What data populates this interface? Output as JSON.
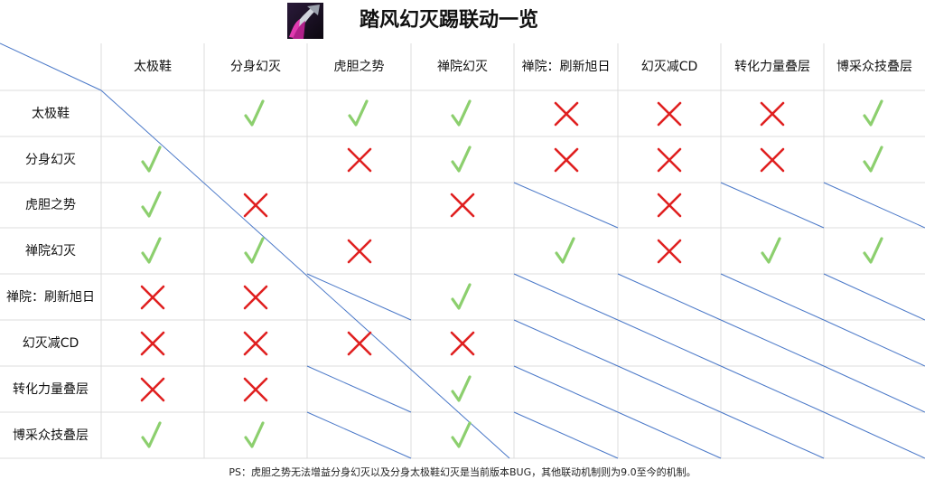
{
  "title": "踏风幻灭踢联动一览",
  "logo_icon": "skill-boot-icon",
  "columns": [
    "太极鞋",
    "分身幻灭",
    "虎胆之势",
    "禅院幻灭",
    "禅院：刷新旭日",
    "幻灭减CD",
    "转化力量叠层",
    "博采众技叠层"
  ],
  "rows": [
    {
      "label": "太极鞋",
      "cells": [
        "empty",
        "check",
        "check",
        "check",
        "cross",
        "cross",
        "cross",
        "check"
      ]
    },
    {
      "label": "分身幻灭",
      "cells": [
        "check",
        "empty",
        "cross",
        "check",
        "cross",
        "cross",
        "cross",
        "check"
      ]
    },
    {
      "label": "虎胆之势",
      "cells": [
        "check",
        "cross",
        "empty",
        "cross",
        "slash",
        "cross",
        "slash",
        "slash"
      ]
    },
    {
      "label": "禅院幻灭",
      "cells": [
        "check",
        "check",
        "cross",
        "empty",
        "check",
        "cross",
        "check",
        "check"
      ]
    },
    {
      "label": "禅院：刷新旭日",
      "cells": [
        "cross",
        "cross",
        "slash",
        "check",
        "slash",
        "slash",
        "slash",
        "slash"
      ]
    },
    {
      "label": "幻灭减CD",
      "cells": [
        "cross",
        "cross",
        "cross",
        "cross",
        "slash",
        "slash",
        "slash",
        "slash"
      ]
    },
    {
      "label": "转化力量叠层",
      "cells": [
        "cross",
        "cross",
        "slash",
        "check",
        "slash",
        "slash",
        "slash",
        "slash"
      ]
    },
    {
      "label": "博采众技叠层",
      "cells": [
        "check",
        "check",
        "slash",
        "check",
        "slash",
        "slash",
        "slash",
        "slash"
      ]
    }
  ],
  "colors": {
    "check": "#8ccf6e",
    "cross": "#e02020",
    "line": "#4a78c8",
    "grid": "#dcdcdc"
  },
  "footnote": "PS：虎胆之势无法增益分身幻灭以及分身太极鞋幻灭是当前版本BUG，其他联动机制则为9.0至今的机制。"
}
